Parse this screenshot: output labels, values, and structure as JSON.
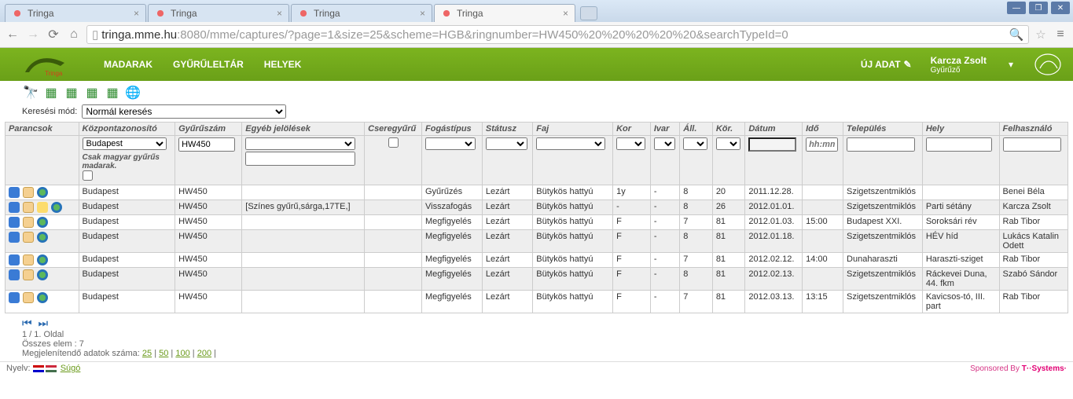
{
  "browser": {
    "tabs": [
      "Tringa",
      "Tringa",
      "Tringa",
      "Tringa"
    ],
    "active_tab_index": 3,
    "url_host": "tringa.mme.hu",
    "url_path": ":8080/mme/captures/?page=1&size=25&scheme=HGB&ringnumber=HW450%20%20%20%20%20&searchTypeId=0",
    "win_min": "—",
    "win_max": "❐",
    "win_close": "✕"
  },
  "header": {
    "nav": [
      "MADARAK",
      "GYŰRŰLELTÁR",
      "HELYEK"
    ],
    "new_data": "ÚJ ADAT",
    "user_name": "Karcza Zsolt",
    "user_role": "Gyűrűző"
  },
  "search_mode": {
    "label": "Keresési mód:",
    "value": "Normál keresés"
  },
  "columns": [
    "Parancsok",
    "Központazonosító",
    "Gyűrűszám",
    "Egyéb jelölések",
    "Cseregyűrű",
    "Fogástípus",
    "Státusz",
    "Faj",
    "Kor",
    "Ivar",
    "Áll.",
    "Kör.",
    "Dátum",
    "Idő",
    "Település",
    "Hely",
    "Felhasználó"
  ],
  "filters": {
    "kp_value": "Budapest",
    "kp_note": "Csak magyar gyűrűs madarak.",
    "ring": "HW450",
    "ido_placeholder": "hh:mm"
  },
  "rows": [
    {
      "kp": "Budapest",
      "ring": "HW450",
      "egy": "",
      "fog": "Gyűrűzés",
      "stat": "Lezárt",
      "faj": "Bütykös hattyú",
      "kor": "1y",
      "ivar": "-",
      "all": "8",
      "kort": "20",
      "datum": "2011.12.28.",
      "ido": "",
      "tel": "Szigetszentmiklós",
      "hely": "",
      "felh": "Benei Béla",
      "edit": false
    },
    {
      "kp": "Budapest",
      "ring": "HW450",
      "egy": "[Színes gyűrű,sárga,17TE,]",
      "fog": "Visszafogás",
      "stat": "Lezárt",
      "faj": "Bütykös hattyú",
      "kor": "-",
      "ivar": "-",
      "all": "8",
      "kort": "26",
      "datum": "2012.01.01.",
      "ido": "",
      "tel": "Szigetszentmiklós",
      "hely": "Parti sétány",
      "felh": "Karcza Zsolt",
      "edit": true
    },
    {
      "kp": "Budapest",
      "ring": "HW450",
      "egy": "",
      "fog": "Megfigyelés",
      "stat": "Lezárt",
      "faj": "Bütykös hattyú",
      "kor": "F",
      "ivar": "-",
      "all": "7",
      "kort": "81",
      "datum": "2012.01.03.",
      "ido": "15:00",
      "tel": "Budapest XXI.",
      "hely": "Soroksári rév",
      "felh": "Rab Tibor",
      "edit": false
    },
    {
      "kp": "Budapest",
      "ring": "HW450",
      "egy": "",
      "fog": "Megfigyelés",
      "stat": "Lezárt",
      "faj": "Bütykös hattyú",
      "kor": "F",
      "ivar": "-",
      "all": "8",
      "kort": "81",
      "datum": "2012.01.18.",
      "ido": "",
      "tel": "Szigetszentmiklós",
      "hely": "HÉV híd",
      "felh": "Lukács Katalin Odett",
      "edit": false
    },
    {
      "kp": "Budapest",
      "ring": "HW450",
      "egy": "",
      "fog": "Megfigyelés",
      "stat": "Lezárt",
      "faj": "Bütykös hattyú",
      "kor": "F",
      "ivar": "-",
      "all": "7",
      "kort": "81",
      "datum": "2012.02.12.",
      "ido": "14:00",
      "tel": "Dunaharaszti",
      "hely": "Haraszti-sziget",
      "felh": "Rab Tibor",
      "edit": false
    },
    {
      "kp": "Budapest",
      "ring": "HW450",
      "egy": "",
      "fog": "Megfigyelés",
      "stat": "Lezárt",
      "faj": "Bütykös hattyú",
      "kor": "F",
      "ivar": "-",
      "all": "8",
      "kort": "81",
      "datum": "2012.02.13.",
      "ido": "",
      "tel": "Szigetszentmiklós",
      "hely": "Ráckevei Duna, 44. fkm",
      "felh": "Szabó Sándor",
      "edit": false
    },
    {
      "kp": "Budapest",
      "ring": "HW450",
      "egy": "",
      "fog": "Megfigyelés",
      "stat": "Lezárt",
      "faj": "Bütykös hattyú",
      "kor": "F",
      "ivar": "-",
      "all": "7",
      "kort": "81",
      "datum": "2012.03.13.",
      "ido": "13:15",
      "tel": "Szigetszentmiklós",
      "hely": "Kavicsos-tó, III. part",
      "felh": "Rab Tibor",
      "edit": false
    }
  ],
  "pager": {
    "page_info": "1 / 1. Oldal",
    "total": "Összes elem : 7",
    "sizes_label": "Megjelenítendő adatok száma:",
    "sizes": [
      "25",
      "50",
      "100",
      "200"
    ]
  },
  "footer": {
    "lang_label": "Nyelv:",
    "help": "Súgó",
    "sponsor_prefix": "Sponsored By",
    "sponsor_brand": "T··Systems·"
  }
}
